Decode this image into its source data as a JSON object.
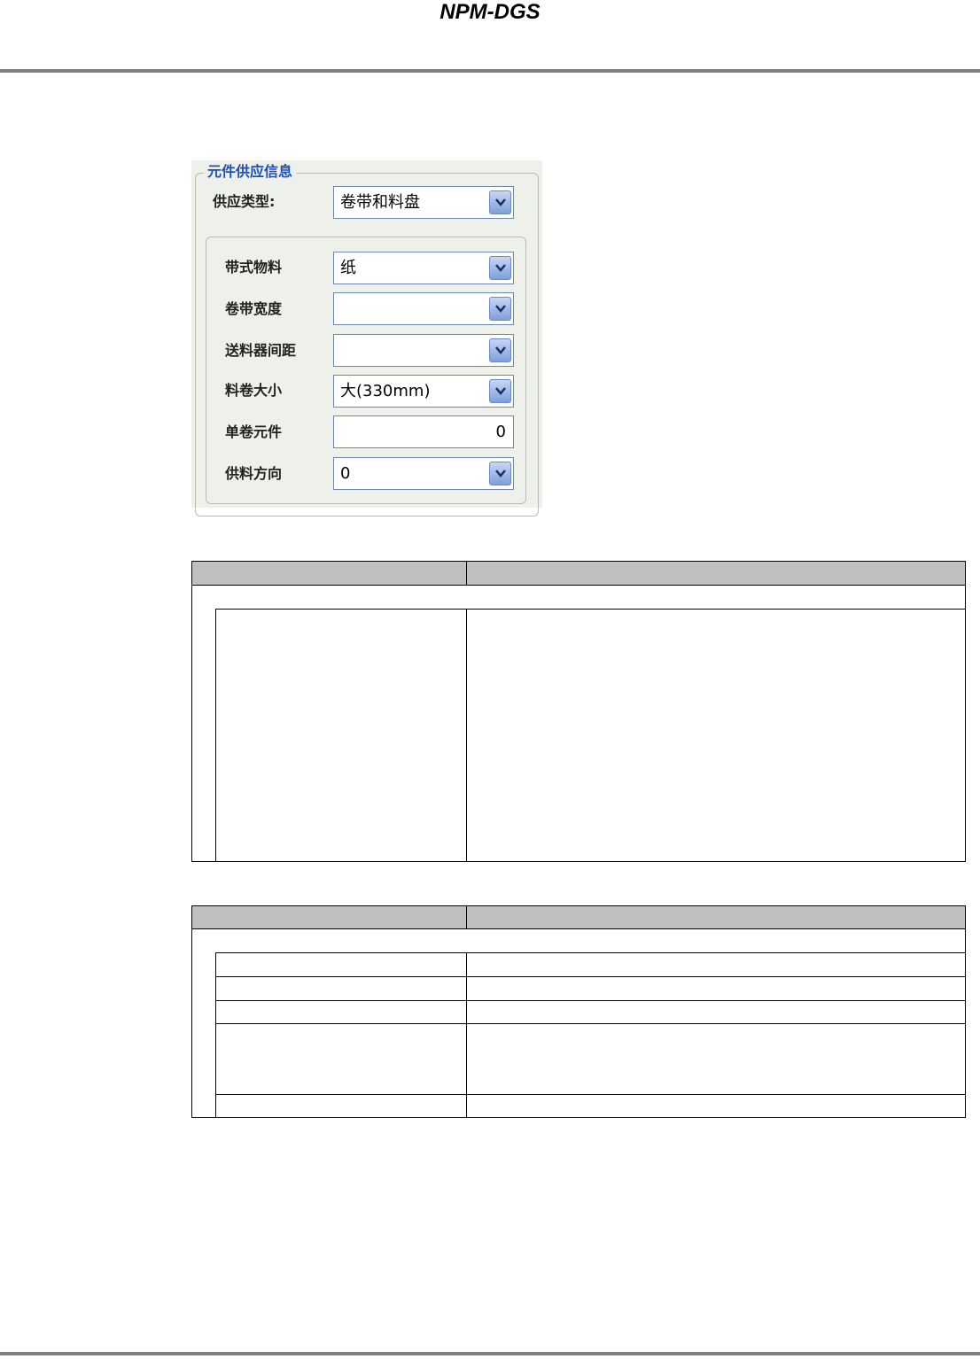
{
  "header": {
    "title": "NPM-DGS"
  },
  "dialog": {
    "group_title": "元件供应信息",
    "supply_type": {
      "label": "供应类型:",
      "value": "卷带和料盘"
    },
    "fields": [
      {
        "label": "带式物料",
        "value": "纸",
        "kind": "dropdown"
      },
      {
        "label": "卷带宽度",
        "value": "",
        "kind": "dropdown"
      },
      {
        "label": "送料器间距",
        "value": "",
        "kind": "dropdown"
      },
      {
        "label": "料卷大小",
        "value": "大(330mm)",
        "kind": "dropdown"
      },
      {
        "label": "单卷元件",
        "value": "0",
        "kind": "number"
      },
      {
        "label": "供料方向",
        "value": "0",
        "kind": "dropdown"
      }
    ]
  },
  "colors": {
    "header_fill": "#c0c0c0",
    "rule": "#7f7f7f",
    "group_title": "#1d4fb8"
  }
}
